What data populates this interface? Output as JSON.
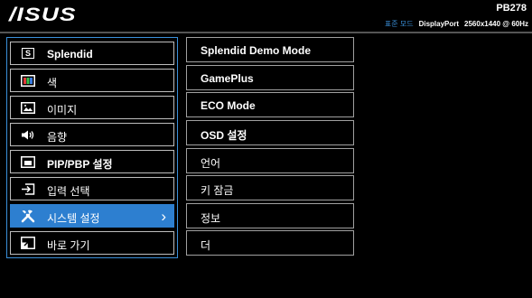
{
  "brand": {
    "logo": "/ISUS"
  },
  "header": {
    "model": "PB278",
    "mode": "표준 모드",
    "input": "DisplayPort",
    "resolution": "2560x1440 @ 60Hz"
  },
  "main_menu": {
    "items": [
      {
        "label": "Splendid",
        "icon": "splendid-icon",
        "selected": false,
        "bold": true
      },
      {
        "label": "색",
        "icon": "color-icon",
        "selected": false,
        "bold": false
      },
      {
        "label": "이미지",
        "icon": "image-icon",
        "selected": false,
        "bold": false
      },
      {
        "label": "음향",
        "icon": "sound-icon",
        "selected": false,
        "bold": false
      },
      {
        "label": "PIP/PBP 설정",
        "icon": "pip-icon",
        "selected": false,
        "bold": true
      },
      {
        "label": "입력 선택",
        "icon": "input-select-icon",
        "selected": false,
        "bold": false
      },
      {
        "label": "시스템 설정",
        "icon": "system-setup-icon",
        "selected": true,
        "bold": false
      },
      {
        "label": "바로 가기",
        "icon": "shortcut-icon",
        "selected": false,
        "bold": false
      }
    ],
    "chevron": "›"
  },
  "sub_menu": {
    "items": [
      {
        "label": "Splendid Demo Mode",
        "bold": true
      },
      {
        "label": "GamePlus",
        "bold": true
      },
      {
        "label": "ECO Mode",
        "bold": true
      },
      {
        "label": "OSD 설정",
        "bold": true
      },
      {
        "label": "언어",
        "bold": false
      },
      {
        "label": "키 잠금",
        "bold": false
      },
      {
        "label": "정보",
        "bold": false
      },
      {
        "label": "더",
        "bold": false
      }
    ]
  },
  "colors": {
    "accent": "#2d7fd0",
    "mode_text": "#3a8fd9",
    "border": "#bdbdbd"
  }
}
